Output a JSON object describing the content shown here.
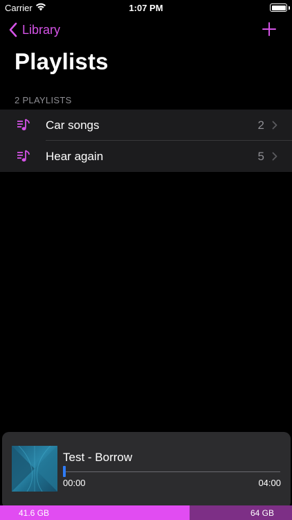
{
  "status_bar": {
    "carrier": "Carrier",
    "time": "1:07 PM",
    "icons": [
      "wifi-icon",
      "battery-icon"
    ]
  },
  "nav": {
    "back_label": "Library",
    "back_icon": "chevron-left-icon",
    "add_icon": "plus-icon",
    "title": "Playlists"
  },
  "colors": {
    "accent": "#d453e6",
    "background": "#000000",
    "row_background": "#1c1c1e",
    "player_background": "#2c2c2e",
    "progress": "#2f7cf6",
    "storage_used": "#e14cf2",
    "storage_free": "#7d2f86"
  },
  "playlists": {
    "header": "2 PLAYLISTS",
    "items": [
      {
        "label": "Car songs",
        "count": "2",
        "icon": "playlist-icon"
      },
      {
        "label": "Hear again",
        "count": "5",
        "icon": "playlist-icon"
      }
    ]
  },
  "player": {
    "track_title": "Test - Borrow",
    "elapsed": "00:00",
    "total": "04:00",
    "progress_fraction": 0.0
  },
  "storage": {
    "used_label": "41.6 GB",
    "total_label": "64 GB",
    "used_fraction": 0.65
  }
}
